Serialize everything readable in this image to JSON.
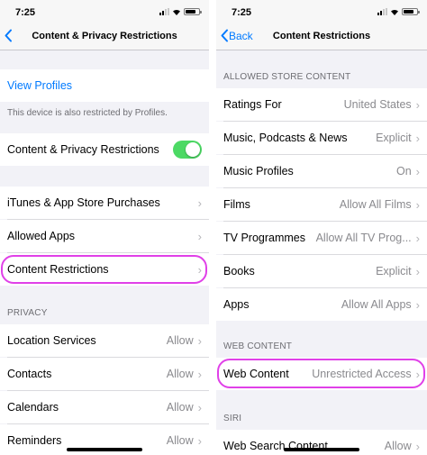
{
  "left": {
    "status_time": "7:25",
    "nav_title": "Content & Privacy Restrictions",
    "view_profiles": "View Profiles",
    "profile_note": "This device is also restricted by Profiles.",
    "restrictions_toggle_label": "Content & Privacy Restrictions",
    "restrictions_toggle_on": true,
    "items": [
      {
        "label": "iTunes & App Store Purchases"
      },
      {
        "label": "Allowed Apps"
      },
      {
        "label": "Content Restrictions"
      }
    ],
    "privacy_header": "PRIVACY",
    "privacy_items": [
      {
        "label": "Location Services",
        "value": "Allow"
      },
      {
        "label": "Contacts",
        "value": "Allow"
      },
      {
        "label": "Calendars",
        "value": "Allow"
      },
      {
        "label": "Reminders",
        "value": "Allow"
      }
    ]
  },
  "right": {
    "status_time": "7:25",
    "back_label": "Back",
    "nav_title": "Content Restrictions",
    "store_header": "ALLOWED STORE CONTENT",
    "store_items": [
      {
        "label": "Ratings For",
        "value": "United States"
      },
      {
        "label": "Music, Podcasts & News",
        "value": "Explicit"
      },
      {
        "label": "Music Profiles",
        "value": "On"
      },
      {
        "label": "Films",
        "value": "Allow All Films"
      },
      {
        "label": "TV Programmes",
        "value": "Allow All TV Prog..."
      },
      {
        "label": "Books",
        "value": "Explicit"
      },
      {
        "label": "Apps",
        "value": "Allow All Apps"
      }
    ],
    "web_header": "WEB CONTENT",
    "web_item": {
      "label": "Web Content",
      "value": "Unrestricted Access"
    },
    "siri_header": "SIRI",
    "siri_item": {
      "label": "Web Search Content",
      "value": "Allow"
    }
  },
  "chevron": "›",
  "colors": {
    "accent": "#007aff",
    "toggle_on": "#4cd964",
    "highlight": "#e040e8"
  },
  "icons": [
    "back-chevron-icon",
    "signal-icon",
    "wifi-icon",
    "battery-icon",
    "chevron-right-icon"
  ]
}
